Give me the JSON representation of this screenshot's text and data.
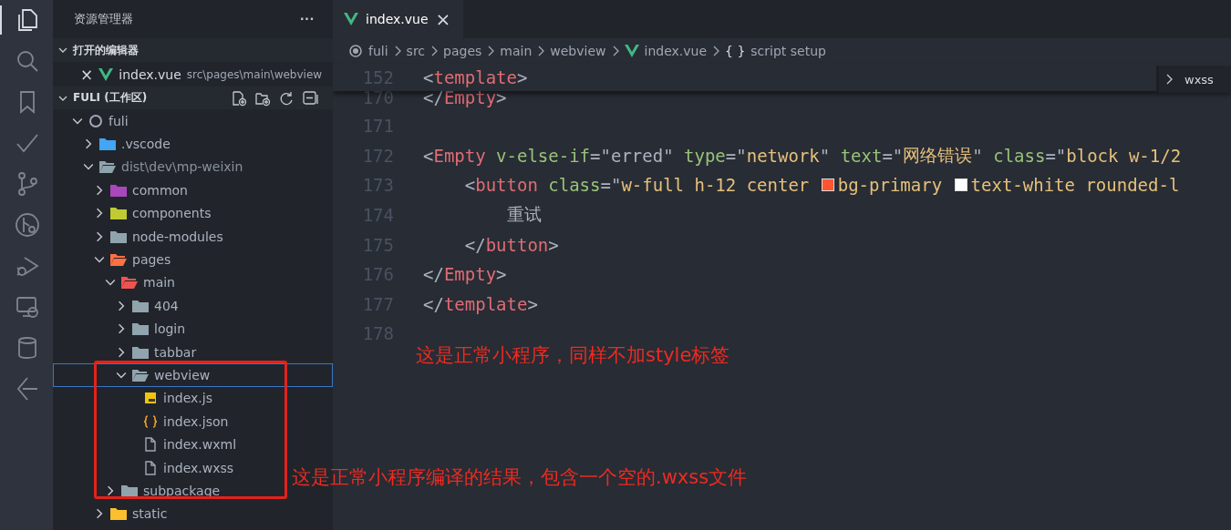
{
  "activity_bar": [
    {
      "selected": true
    },
    {
      "selected": false
    },
    {
      "selected": false
    },
    {
      "selected": false
    },
    {
      "selected": false
    },
    {
      "selected": false
    },
    {
      "selected": false
    },
    {
      "selected": false
    },
    {
      "selected": false
    },
    {
      "selected": false
    }
  ],
  "sidebar": {
    "title": "资源管理器",
    "more": "···",
    "open_editors": {
      "title": "打开的编辑器",
      "expanded": true,
      "items": [
        {
          "name": "index.vue",
          "path": "src\\pages\\main\\webview",
          "close": "×"
        }
      ]
    },
    "workspace": {
      "title": "FULI (工作区)",
      "expanded": true,
      "tree": [
        {
          "name": "fuli",
          "kind": "root",
          "expanded": true,
          "selected": false,
          "children": [
            {
              "name": ".vscode",
              "kind": "vscode",
              "expanded": false,
              "selected": false
            },
            {
              "name": "dist\\dev\\mp-weixin",
              "kind": "dist",
              "expanded": true,
              "selected": false,
              "children": [
                {
                  "name": "common",
                  "kind": "common",
                  "expanded": false,
                  "selected": false
                },
                {
                  "name": "components",
                  "kind": "components",
                  "expanded": false,
                  "selected": false
                },
                {
                  "name": "node-modules",
                  "kind": "folder",
                  "expanded": false,
                  "selected": false
                },
                {
                  "name": "pages",
                  "kind": "pages",
                  "expanded": true,
                  "selected": false,
                  "children": [
                    {
                      "name": "main",
                      "kind": "home",
                      "expanded": true,
                      "selected": false,
                      "children": [
                        {
                          "name": "404",
                          "kind": "folder",
                          "expanded": false,
                          "selected": false
                        },
                        {
                          "name": "login",
                          "kind": "folder",
                          "expanded": false,
                          "selected": false
                        },
                        {
                          "name": "tabbar",
                          "kind": "folder",
                          "expanded": false,
                          "selected": false
                        },
                        {
                          "name": "webview",
                          "kind": "folder",
                          "expanded": true,
                          "selected": true,
                          "children": [
                            {
                              "name": "index.js",
                              "kind": "js",
                              "selected": false
                            },
                            {
                              "name": "index.json",
                              "kind": "json",
                              "selected": false
                            },
                            {
                              "name": "index.wxml",
                              "kind": "file",
                              "selected": false
                            },
                            {
                              "name": "index.wxss",
                              "kind": "file",
                              "selected": false
                            }
                          ]
                        }
                      ]
                    },
                    {
                      "name": "subpackage",
                      "kind": "folder",
                      "expanded": false,
                      "selected": false
                    }
                  ]
                },
                {
                  "name": "static",
                  "kind": "static",
                  "expanded": false,
                  "selected": false
                }
              ]
            }
          ]
        }
      ]
    }
  },
  "tabs": [
    {
      "label": "index.vue",
      "close": "×",
      "selected": true
    }
  ],
  "breadcrumbs": [
    {
      "label": "fuli",
      "kind": "root"
    },
    {
      "label": "src",
      "kind": "plain"
    },
    {
      "label": "pages",
      "kind": "plain"
    },
    {
      "label": "main",
      "kind": "plain"
    },
    {
      "label": "webview",
      "kind": "plain"
    },
    {
      "label": "index.vue",
      "kind": "vue"
    },
    {
      "label": "script setup",
      "kind": "symbol",
      "symbol": "{ }"
    }
  ],
  "sticky": {
    "number": "152",
    "tokens": [
      {
        "kind": "punct",
        "text": "<"
      },
      {
        "kind": "tag",
        "text": "template"
      },
      {
        "kind": "punct",
        "text": ">"
      }
    ]
  },
  "partial_line": {
    "number": "170",
    "tokens": [
      {
        "kind": "punct",
        "text": "</"
      },
      {
        "kind": "tag",
        "text": "Empty"
      },
      {
        "kind": "punct",
        "text": ">"
      }
    ]
  },
  "lines": [
    {
      "number": "171"
    },
    {
      "number": "172",
      "tokens": [
        {
          "kind": "punct",
          "text": "<"
        },
        {
          "kind": "tag",
          "text": "Empty"
        },
        {
          "kind": "attr",
          "text": " v-else-if"
        },
        {
          "kind": "punct",
          "text": "=\""
        },
        {
          "kind": "text",
          "text": "erred"
        },
        {
          "kind": "punct",
          "text": "\" "
        },
        {
          "kind": "attr",
          "text": "type"
        },
        {
          "kind": "punct",
          "text": "=\""
        },
        {
          "kind": "string",
          "text": "network"
        },
        {
          "kind": "punct",
          "text": "\" "
        },
        {
          "kind": "attr",
          "text": "text"
        },
        {
          "kind": "punct",
          "text": "=\""
        },
        {
          "kind": "string",
          "text": "网络错误"
        },
        {
          "kind": "punct",
          "text": "\" "
        },
        {
          "kind": "attr",
          "text": "class"
        },
        {
          "kind": "punct",
          "text": "=\""
        },
        {
          "kind": "string",
          "text": "block w-1/2"
        }
      ]
    },
    {
      "number": "173",
      "tokens": [
        {
          "kind": "punct",
          "text": "    <"
        },
        {
          "kind": "tag",
          "text": "button"
        },
        {
          "kind": "attr",
          "text": " class"
        },
        {
          "kind": "punct",
          "text": "=\""
        },
        {
          "kind": "string",
          "text": "w-full h-12 center "
        },
        {
          "kind": "swatch",
          "color": "#ff5533"
        },
        {
          "kind": "string",
          "text": "bg-primary "
        },
        {
          "kind": "swatch",
          "color": "#ffffff"
        },
        {
          "kind": "string",
          "text": "text-white rounded-l"
        }
      ]
    },
    {
      "number": "174",
      "tokens": [
        {
          "kind": "text",
          "text": "        重试"
        }
      ]
    },
    {
      "number": "175",
      "tokens": [
        {
          "kind": "punct",
          "text": "    </"
        },
        {
          "kind": "tag",
          "text": "button"
        },
        {
          "kind": "punct",
          "text": ">"
        }
      ]
    },
    {
      "number": "176",
      "tokens": [
        {
          "kind": "punct",
          "text": "</"
        },
        {
          "kind": "tag",
          "text": "Empty"
        },
        {
          "kind": "punct",
          "text": ">"
        }
      ]
    },
    {
      "number": "177",
      "tokens": [
        {
          "kind": "punct",
          "text": "</"
        },
        {
          "kind": "tag",
          "text": "template"
        },
        {
          "kind": "punct",
          "text": ">"
        }
      ]
    },
    {
      "number": "178"
    }
  ],
  "outline_widget": {
    "label": "wxss"
  },
  "annotations": [
    {
      "text": "这是正常小程序，同样不加style标签"
    },
    {
      "text": "这是正常小程序编译的结果，包含一个空的.wxss文件"
    }
  ]
}
